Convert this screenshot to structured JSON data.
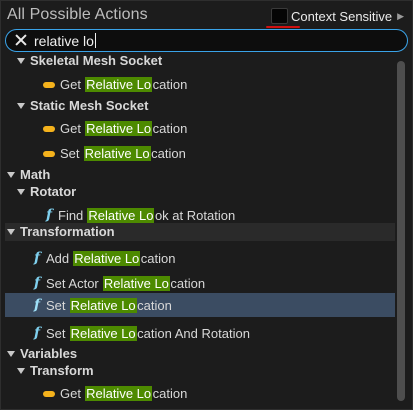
{
  "panel": {
    "title": "All Possible Actions",
    "context_sensitive": {
      "label": "Context Sensitive",
      "checked": true,
      "arrow_icon": "triangle-right"
    },
    "accent_underline_color": "#d01010"
  },
  "search": {
    "value": "relative lo",
    "clear_icon": "close-x"
  },
  "tree": {
    "skeletal": {
      "label": "Skeletal Mesh Socket"
    },
    "skeletal_get": {
      "pre": "Get ",
      "hl": "Relative Lo",
      "post": "cation",
      "icon": "variable-pill"
    },
    "static": {
      "label": "Static Mesh Socket"
    },
    "static_get": {
      "pre": "Get ",
      "hl": "Relative Lo",
      "post": "cation",
      "icon": "variable-pill"
    },
    "static_set": {
      "pre": "Set ",
      "hl": "Relative Lo",
      "post": "cation",
      "icon": "variable-pill"
    },
    "math": {
      "label": "Math"
    },
    "rotator": {
      "label": "Rotator"
    },
    "find_look": {
      "pre": "Find ",
      "hl": "Relative Lo",
      "post": "ok at Rotation",
      "icon": "function-f"
    },
    "transformation": {
      "label": "Transformation"
    },
    "add_rel": {
      "pre": "Add ",
      "hl": "Relative Lo",
      "post": "cation",
      "icon": "function-f"
    },
    "set_actor": {
      "pre": "Set Actor ",
      "hl": "Relative Lo",
      "post": "cation",
      "icon": "function-f"
    },
    "set_rel": {
      "pre": "Set ",
      "hl": "Relative Lo",
      "post": "cation",
      "icon": "function-f",
      "selected": true
    },
    "set_rel_rot": {
      "pre": "Set ",
      "hl": "Relative Lo",
      "post": "cation And Rotation",
      "icon": "function-f"
    },
    "variables": {
      "label": "Variables"
    },
    "transform": {
      "label": "Transform"
    },
    "transform_get": {
      "pre": "Get ",
      "hl": "Relative Lo",
      "post": "cation",
      "icon": "variable-pill"
    }
  },
  "colors": {
    "highlight": "#4d8a00",
    "selected_row": "#3b4c62",
    "variable_pill": "#f4b21c",
    "function_icon": "#7fd0ee",
    "search_border": "#3aa3e8"
  }
}
